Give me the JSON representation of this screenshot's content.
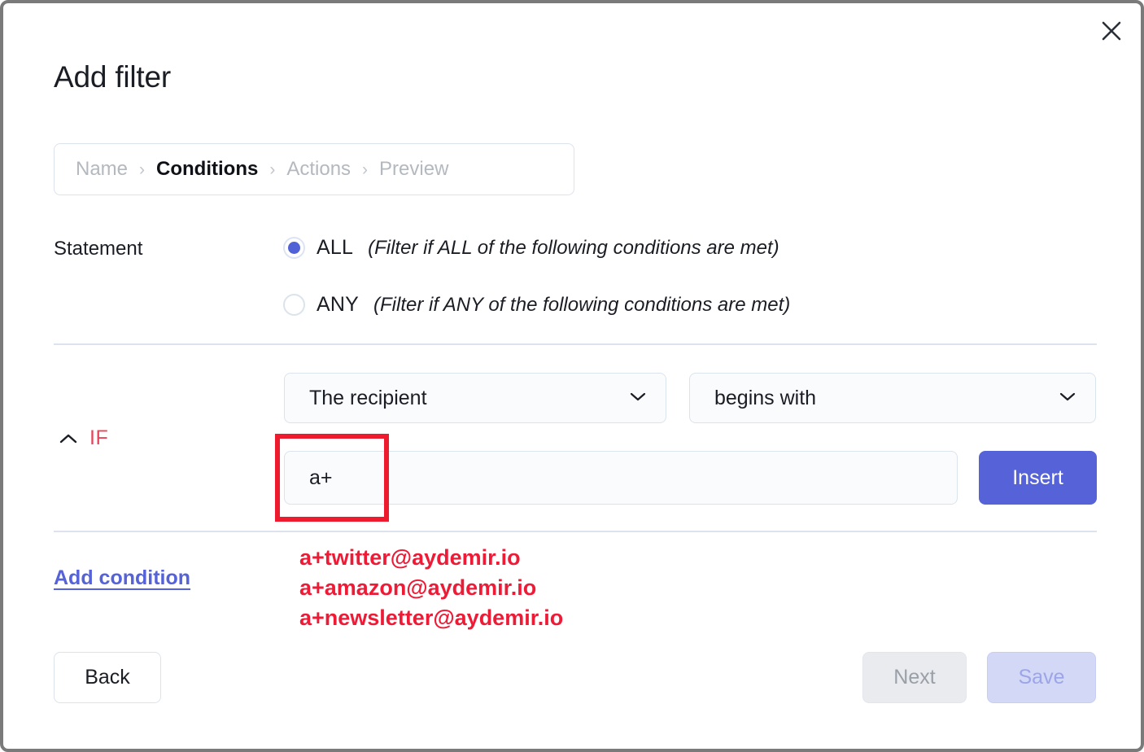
{
  "window": {
    "close_icon": "close-icon"
  },
  "dialog": {
    "title": "Add filter"
  },
  "breadcrumb": {
    "separator": "›",
    "steps": [
      {
        "label": "Name",
        "active": false
      },
      {
        "label": "Conditions",
        "active": true
      },
      {
        "label": "Actions",
        "active": false
      },
      {
        "label": "Preview",
        "active": false
      }
    ]
  },
  "statement": {
    "label": "Statement",
    "options": [
      {
        "value": "ALL",
        "description": "(Filter if ALL of the following conditions are met)",
        "selected": true
      },
      {
        "value": "ANY",
        "description": "(Filter if ANY of the following conditions are met)",
        "selected": false
      }
    ]
  },
  "condition": {
    "if_label": "IF",
    "collapse_icon": "chevron-up-icon",
    "field_select": {
      "value": "The recipient",
      "icon": "chevron-down-icon"
    },
    "operator_select": {
      "value": "begins with",
      "icon": "chevron-down-icon"
    },
    "value_input": {
      "value": "a+",
      "placeholder": ""
    },
    "insert_label": "Insert"
  },
  "add_condition_label": "Add condition",
  "footer": {
    "back_label": "Back",
    "next_label": "Next",
    "save_label": "Save"
  },
  "annotations": {
    "highlight_color": "#ee1b2e",
    "text_color": "#ee1b37",
    "lines": [
      "a+twitter@aydemir.io",
      "a+amazon@aydemir.io",
      "a+newsletter@aydemir.io"
    ]
  },
  "colors": {
    "accent": "#5562d8",
    "if_red": "#e8455a",
    "divider": "#dce3ec",
    "border": "#dbe3ec"
  }
}
